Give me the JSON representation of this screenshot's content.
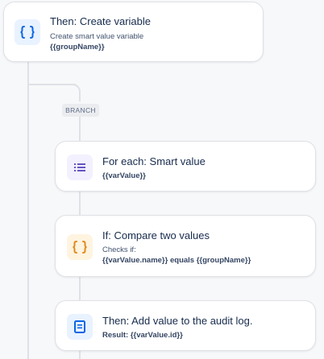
{
  "colors": {
    "variable_accent": "#0c66e4",
    "loop_accent": "#6554c0",
    "condition_accent": "#e2891d",
    "action_accent": "#0c66e4",
    "connector": "#dfe1e6"
  },
  "steps": [
    {
      "title": "Then: Create variable",
      "subtitle": "Create smart value variable",
      "value": "{{groupName}}",
      "icon": "curly-braces-icon"
    },
    {
      "title": "For each: Smart value",
      "value": "{{varValue}}",
      "icon": "list-icon"
    },
    {
      "title": "If: Compare two values",
      "subtitle": "Checks if:",
      "detail_left": "{{varValue.name}}",
      "detail_op": "equals",
      "detail_right": "{{groupName}}",
      "icon": "curly-braces-icon"
    },
    {
      "title": "Then: Add value to the audit log.",
      "result_label": "Result:",
      "result_value": "{{varValue.id}}",
      "icon": "document-icon"
    }
  ],
  "branch_label": "BRANCH"
}
